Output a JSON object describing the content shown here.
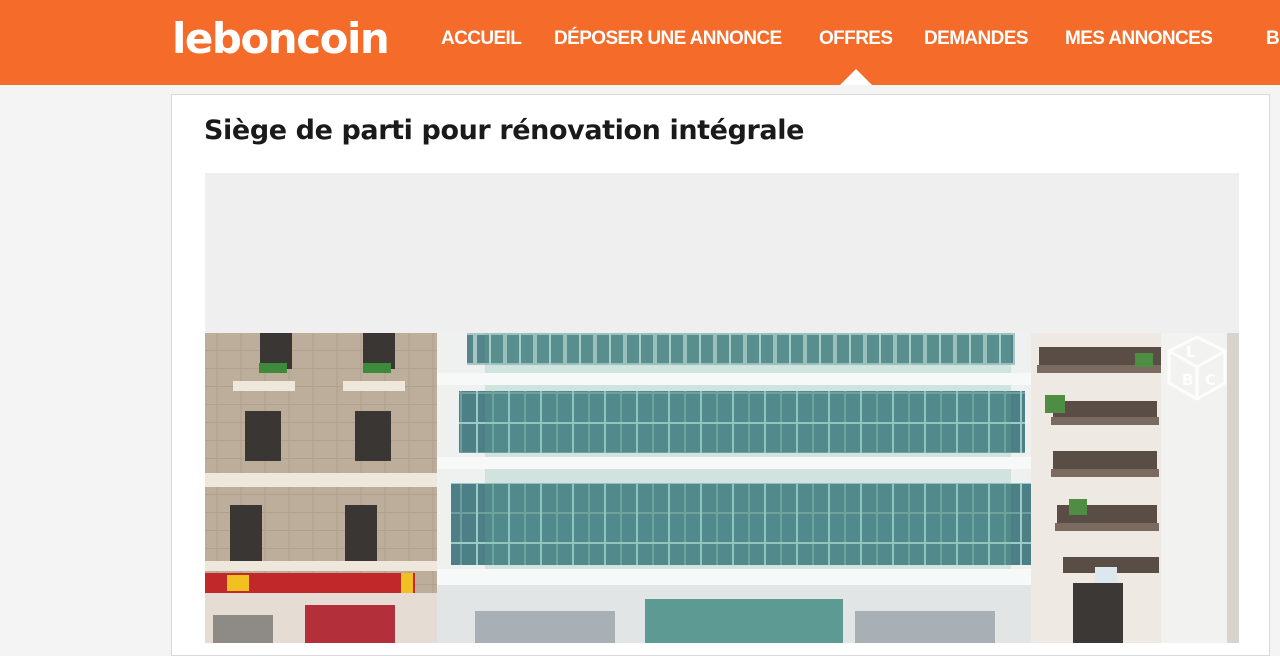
{
  "header": {
    "logo": "leboncoin",
    "nav": [
      "ACCUEIL",
      "DÉPOSER UNE ANNONCE",
      "OFFRES",
      "DEMANDES",
      "MES ANNONCES",
      "B"
    ],
    "active_nav": "OFFRES"
  },
  "ad": {
    "title": "Siège de parti pour rénovation intégrale",
    "photo_alt": "Façade d'immeuble avec façade vitrée",
    "watermark": "LBC"
  },
  "colors": {
    "brand": "#f56b2a"
  }
}
